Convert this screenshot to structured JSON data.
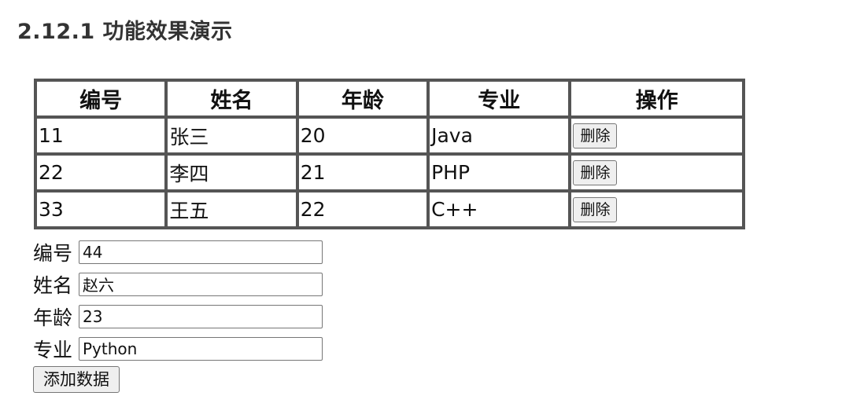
{
  "heading": "2.12.1 功能效果演示",
  "table": {
    "headers": [
      "编号",
      "姓名",
      "年龄",
      "专业",
      "操作"
    ],
    "rows": [
      {
        "id": "11",
        "name": "张三",
        "age": "20",
        "major": "Java",
        "action": "删除"
      },
      {
        "id": "22",
        "name": "李四",
        "age": "21",
        "major": "PHP",
        "action": "删除"
      },
      {
        "id": "33",
        "name": "王五",
        "age": "22",
        "major": "C++",
        "action": "删除"
      }
    ]
  },
  "form": {
    "id_label": "编号",
    "id_value": "44",
    "name_label": "姓名",
    "name_value": "赵六",
    "age_label": "年龄",
    "age_value": "23",
    "major_label": "专业",
    "major_value": "Python",
    "submit_label": "添加数据"
  }
}
